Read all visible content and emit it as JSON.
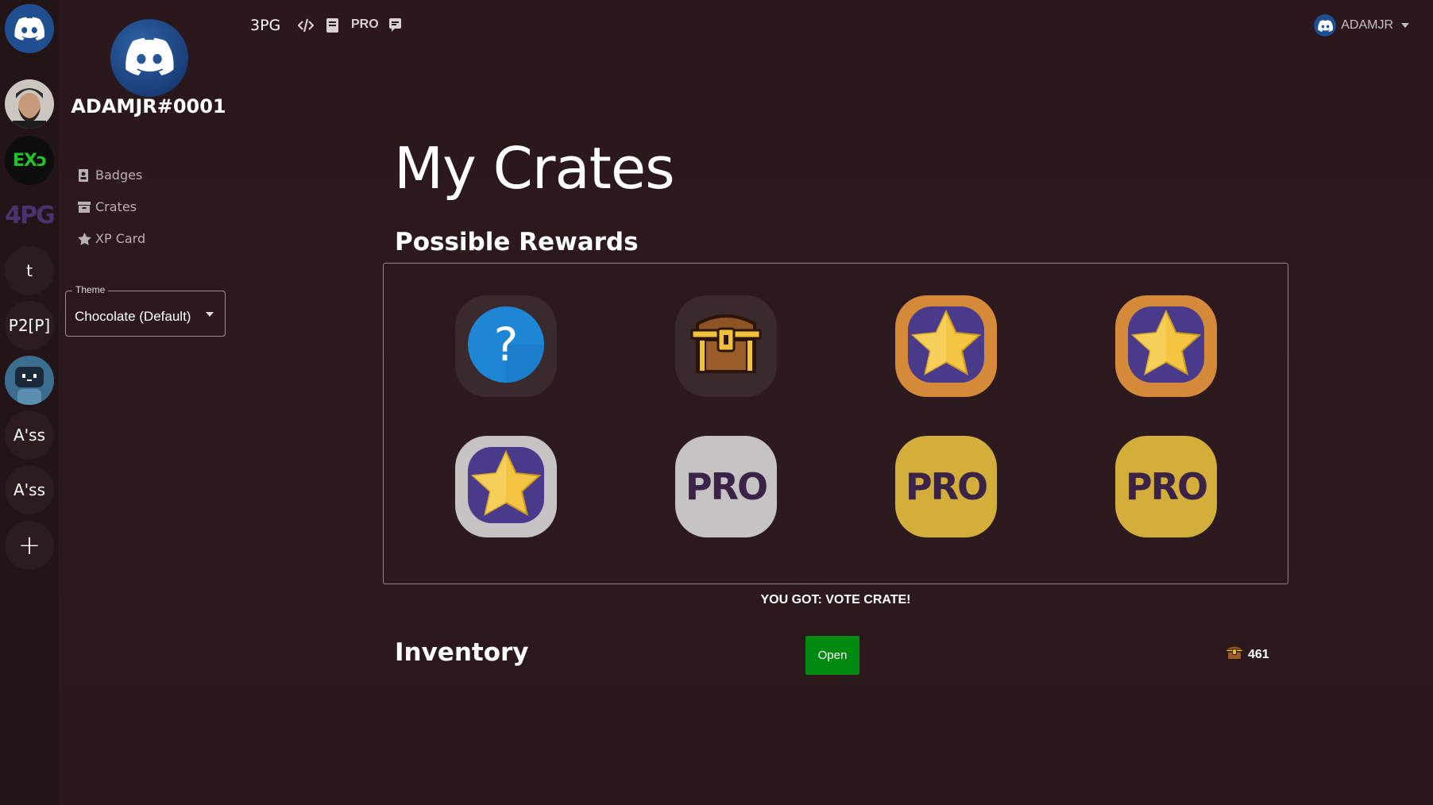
{
  "app": {
    "brand": "3PG"
  },
  "topbar": {
    "items": [
      {
        "icon": "code-icon"
      },
      {
        "icon": "book-icon"
      },
      {
        "label": "PRO"
      },
      {
        "icon": "message-icon"
      }
    ],
    "user": {
      "name": "ADAMJR",
      "avatar_icon": "discord-icon"
    }
  },
  "guilds": [
    {
      "type": "icon",
      "icon": "discord-icon"
    },
    {
      "type": "image",
      "icon": "user-photo"
    },
    {
      "type": "text",
      "label": "EXↄ"
    },
    {
      "type": "text",
      "label": "4PG"
    },
    {
      "type": "text",
      "label": "t"
    },
    {
      "type": "text",
      "label": "P2[P]"
    },
    {
      "type": "icon",
      "icon": "robot-icon"
    },
    {
      "type": "text",
      "label": "A'ss"
    },
    {
      "type": "text",
      "label": "A'ss"
    },
    {
      "type": "text",
      "label": "+"
    }
  ],
  "profile": {
    "username": "ADAMJR#0001"
  },
  "nav": [
    {
      "label": "Badges",
      "icon": "badge-icon"
    },
    {
      "label": "Crates",
      "icon": "crate-icon"
    },
    {
      "label": "XP Card",
      "icon": "star-icon"
    }
  ],
  "theme": {
    "legend": "Theme",
    "value": "Chocolate (Default)"
  },
  "main": {
    "title": "My Crates",
    "rewards_title": "Possible Rewards",
    "rewards": [
      {
        "kind": "question",
        "icon": "question-icon",
        "bg": "#3b2a2d"
      },
      {
        "kind": "chest",
        "icon": "treasure-chest-icon",
        "bg": "#3b2a2d"
      },
      {
        "kind": "star",
        "icon": "star-badge-icon",
        "bg": "#d58a3a"
      },
      {
        "kind": "star",
        "icon": "star-badge-icon",
        "bg": "#d58a3a"
      },
      {
        "kind": "star",
        "icon": "star-badge-icon",
        "bg": "#c6c3c4"
      },
      {
        "kind": "pro",
        "label": "PRO",
        "bg": "#c6c3c4"
      },
      {
        "kind": "pro",
        "label": "PRO",
        "bg": "#d4ae3b"
      },
      {
        "kind": "pro",
        "label": "PRO",
        "bg": "#d4ae3b"
      }
    ],
    "result": "YOU GOT: VOTE CRATE!",
    "inventory_title": "Inventory",
    "open_button": "Open",
    "crate_count": "461"
  },
  "colors": {
    "background": "#2a181c",
    "open_button": "#008a0f",
    "accent_blue": "#1f86d6"
  }
}
